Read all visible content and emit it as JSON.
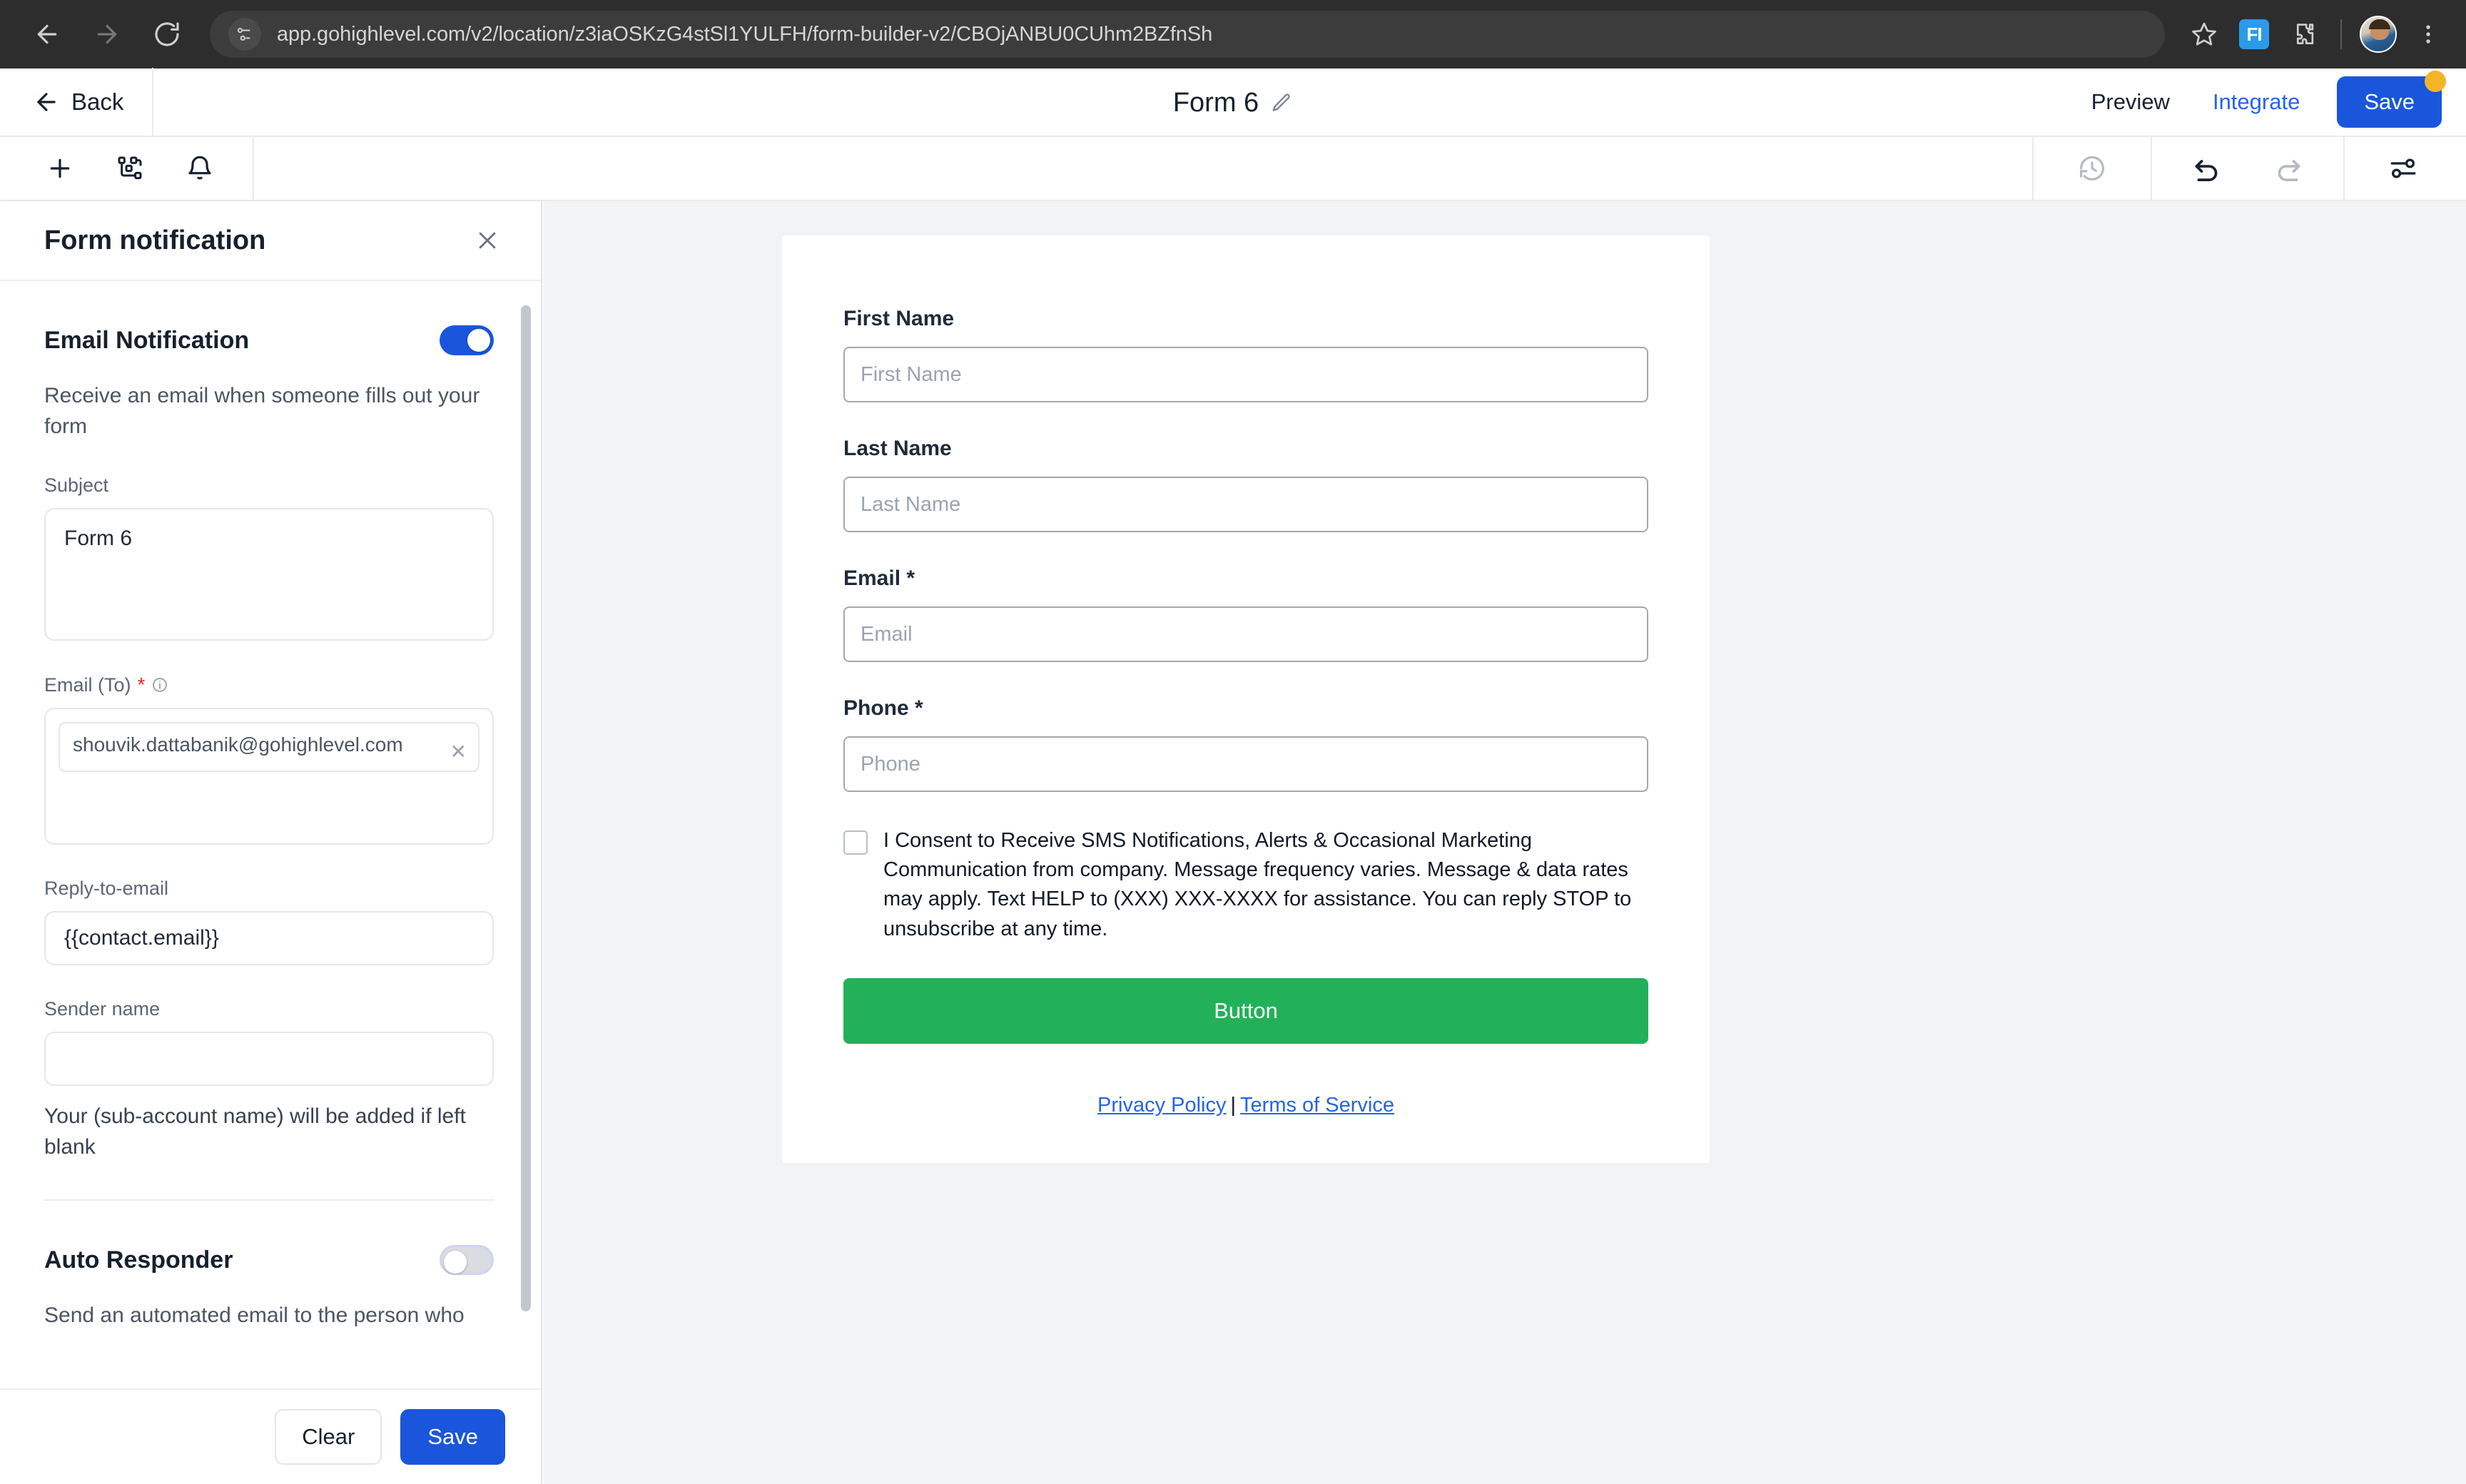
{
  "browser": {
    "url": "app.gohighlevel.com/v2/location/z3iaOSKzG4stSl1YULFH/form-builder-v2/CBOjANBU0CUhm2BZfnSh",
    "extension_label": "FI"
  },
  "header": {
    "back_label": "Back",
    "form_title": "Form 6",
    "preview_label": "Preview",
    "integrate_label": "Integrate",
    "save_label": "Save"
  },
  "panel": {
    "title": "Form notification",
    "email_notification": {
      "title": "Email Notification",
      "toggle_state": "on",
      "description": "Receive an email when someone fills out your form",
      "subject_label": "Subject",
      "subject_value": "Form 6",
      "email_to_label": "Email (To)",
      "email_to_required": "*",
      "email_to_value": "shouvik.dattabanik@gohighlevel.com",
      "reply_to_label": "Reply-to-email",
      "reply_to_value": "{{contact.email}}",
      "sender_name_label": "Sender name",
      "sender_name_value": "",
      "sender_name_help": "Your (sub-account name) will be added if left blank"
    },
    "auto_responder": {
      "title": "Auto Responder",
      "toggle_state": "off",
      "description": "Send an automated email to the person who"
    },
    "footer": {
      "clear_label": "Clear",
      "save_label": "Save"
    }
  },
  "form_preview": {
    "fields": [
      {
        "label": "First Name",
        "required": "",
        "placeholder": "First Name"
      },
      {
        "label": "Last Name",
        "required": "",
        "placeholder": "Last Name"
      },
      {
        "label": "Email",
        "required": "*",
        "placeholder": "Email"
      },
      {
        "label": "Phone",
        "required": "*",
        "placeholder": "Phone"
      }
    ],
    "consent_text": "I Consent to Receive SMS Notifications, Alerts & Occasional Marketing Communication from company. Message frequency varies. Message & data rates may apply. Text HELP to (XXX) XXX-XXXX for assistance. You can reply STOP to unsubscribe at any time.",
    "submit_label": "Button",
    "privacy_label": "Privacy Policy",
    "legal_separator": "|",
    "terms_label": "Terms of Service"
  },
  "colors": {
    "primary_blue": "#1a56db",
    "link_blue": "#2563eb",
    "submit_green": "#22b158",
    "badge_yellow": "#f5b424",
    "required_red": "#dc2626"
  }
}
